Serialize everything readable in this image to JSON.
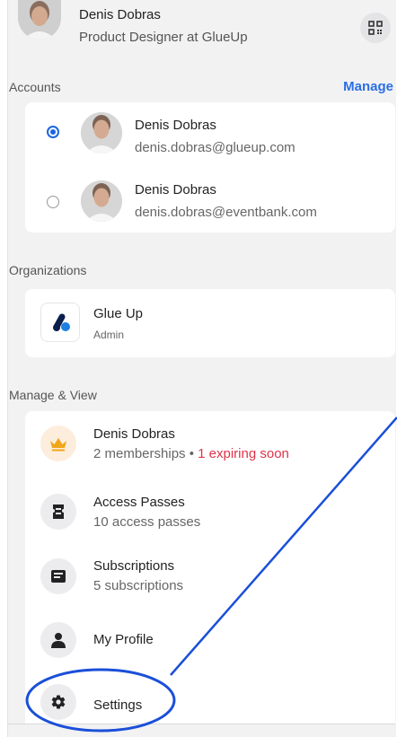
{
  "header": {
    "name": "Denis Dobras",
    "role": "Product Designer at GlueUp",
    "qr_icon": "qr-code-icon"
  },
  "accounts": {
    "label": "Accounts",
    "manage_label": "Manage",
    "items": [
      {
        "name": "Denis Dobras",
        "email": "denis.dobras@glueup.com",
        "selected": true
      },
      {
        "name": "Denis Dobras",
        "email": "denis.dobras@eventbank.com",
        "selected": false
      }
    ]
  },
  "organizations": {
    "label": "Organizations",
    "items": [
      {
        "name": "Glue Up",
        "role": "Admin"
      }
    ]
  },
  "manage_view": {
    "label": "Manage & View",
    "membership": {
      "title": "Denis Dobras",
      "sub": "2 memberships",
      "separator": " • ",
      "expiring": "1 expiring soon",
      "icon": "crown-icon"
    },
    "access_passes": {
      "title": "Access Passes",
      "sub": "10 access passes",
      "icon": "pass-icon"
    },
    "subscriptions": {
      "title": "Subscriptions",
      "sub": "5 subscriptions",
      "icon": "subscription-icon"
    },
    "my_profile": {
      "title": "My Profile",
      "icon": "person-icon"
    },
    "settings": {
      "title": "Settings",
      "icon": "gear-icon"
    }
  },
  "colors": {
    "accent": "#1d65e0",
    "annotation": "#1a4fd8",
    "warning": "#e0334a",
    "crown": "#f0a61a"
  }
}
